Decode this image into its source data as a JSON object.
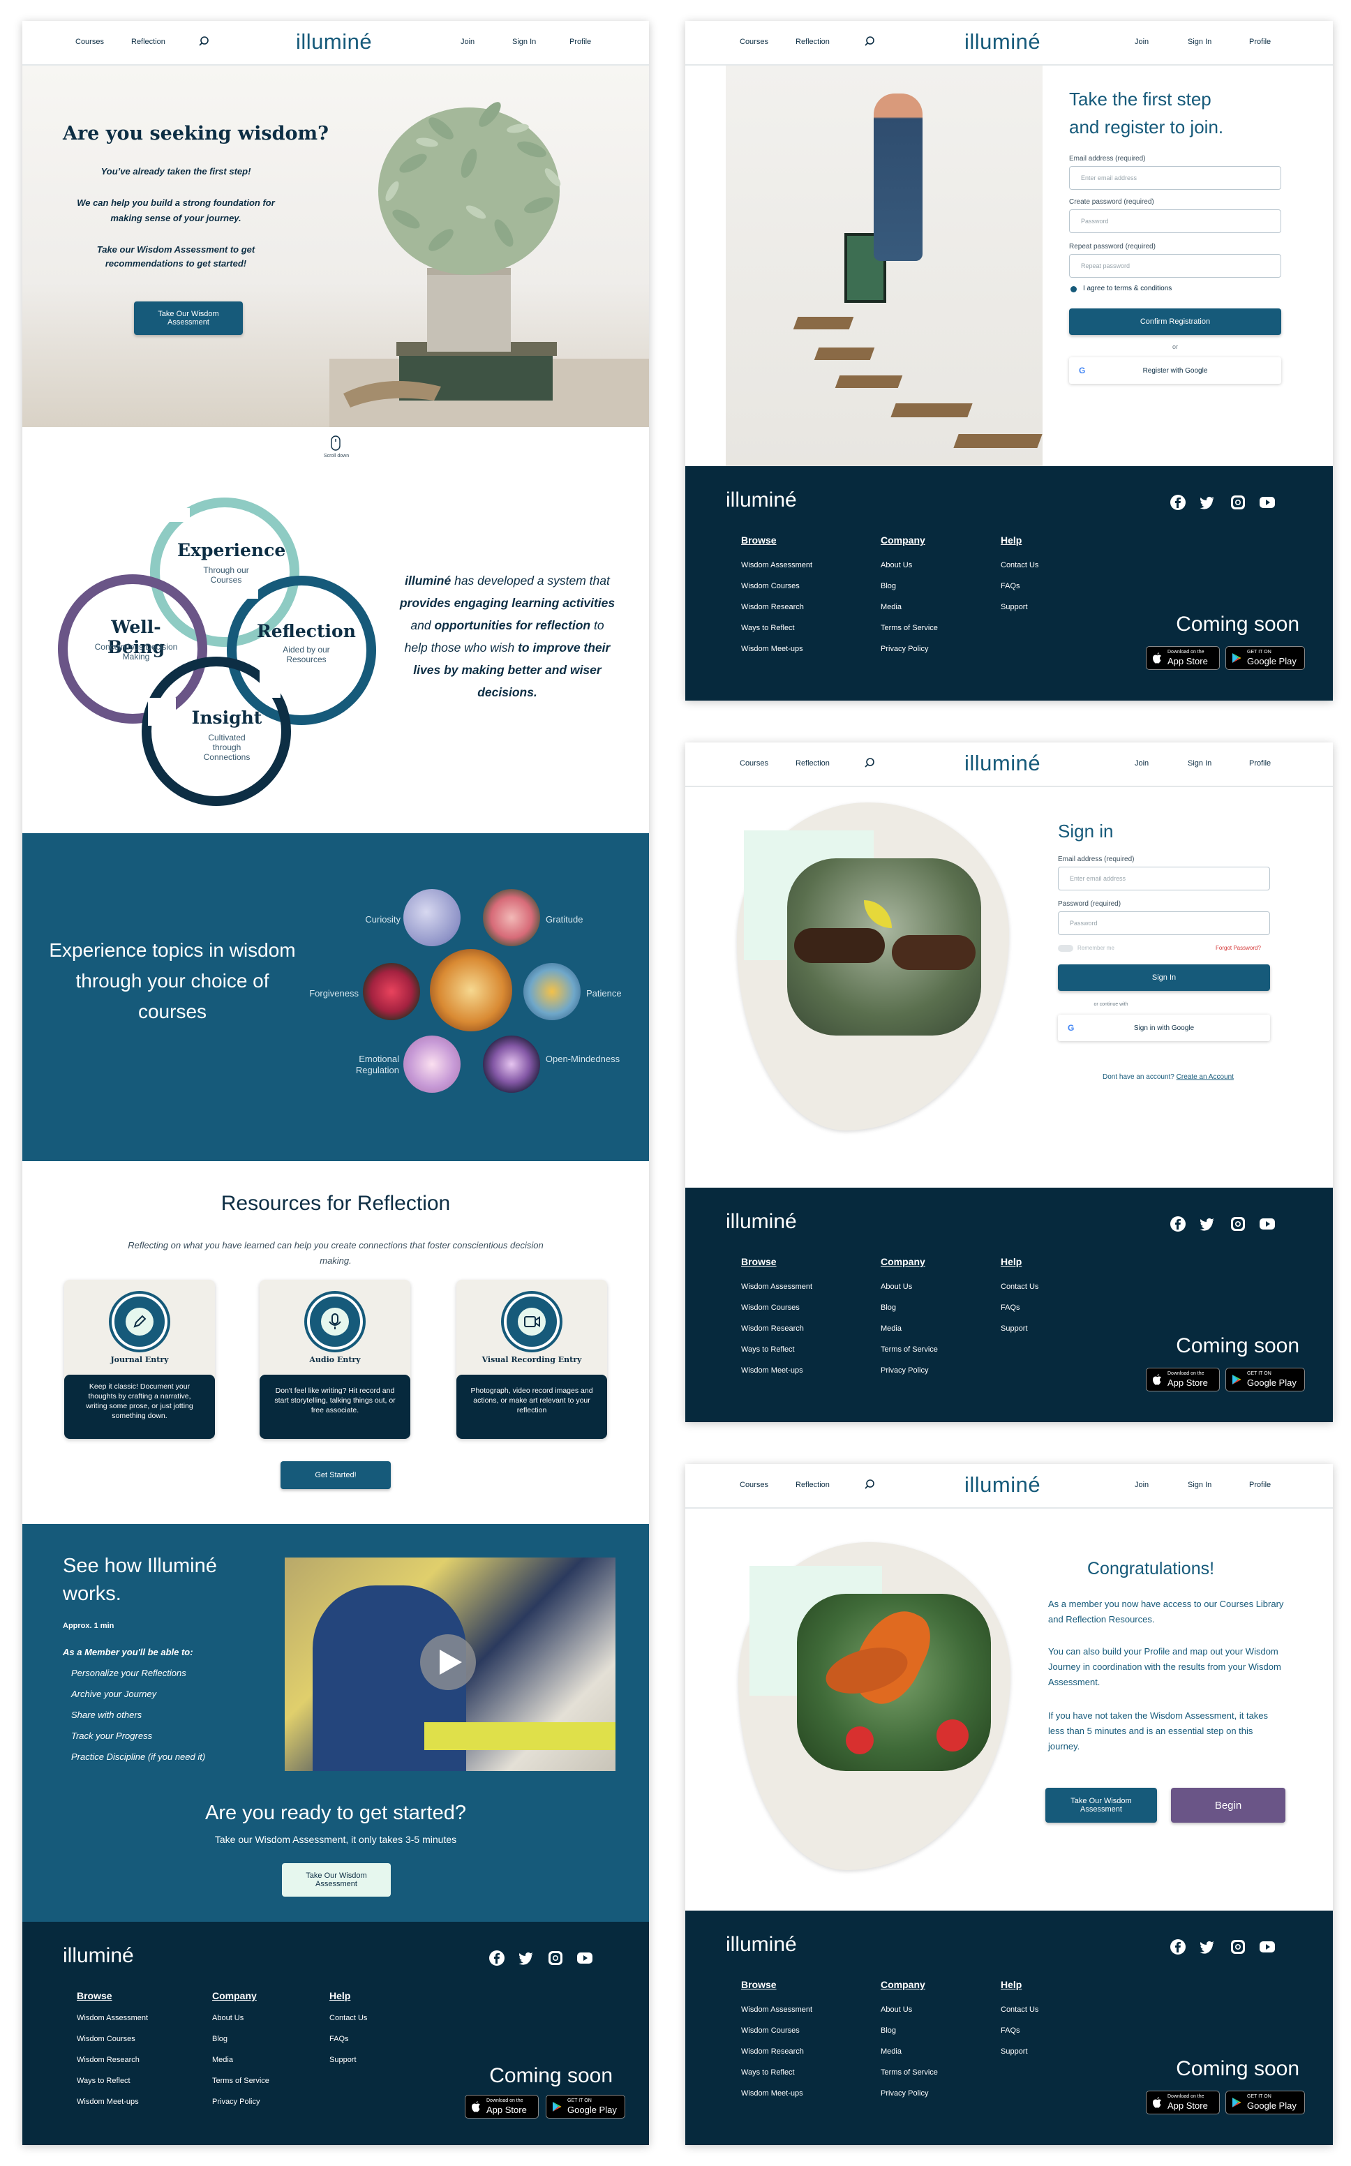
{
  "nav": {
    "courses": "Courses",
    "reflection": "Reflection",
    "logo": "illuminé",
    "join": "Join",
    "sign_in": "Sign In",
    "profile": "Profile"
  },
  "hero": {
    "title": "Are you seeking wisdom?",
    "line1": "You’ve already taken the first step!",
    "line2": "We can help you build a strong foundation for making sense of your journey.",
    "line3": "Take our Wisdom Assessment to get recommendations to get started!",
    "button": "Take Our Wisdom Assessment",
    "scroll": "Scroll down"
  },
  "rings": {
    "experience": {
      "title": "Experience",
      "sub": "Through our Courses"
    },
    "reflection": {
      "title": "Reflection",
      "sub": "Aided by our Resources"
    },
    "wellbeing": {
      "title": "Well-Being",
      "sub": "Conceintious Decision Making"
    },
    "insight": {
      "title": "Insight",
      "sub": "Cultivated through Connections"
    },
    "text_a": "illuminé",
    "text_b": " has developed a system that ",
    "text_c": "provides engaging learning activities",
    "text_d": " and ",
    "text_e": "opportunities for reflection",
    "text_f": " to help those who wish ",
    "text_g": "to improve their lives by making better and wiser decisions."
  },
  "topics": {
    "heading": "Experience topics in wisdom through your choice of courses",
    "curiosity": "Curiosity",
    "gratitude": "Gratitude",
    "forgiveness": "Forgiveness",
    "patience": "Patience",
    "emotional": "Emotional Regulation",
    "open": "Open-Mindedness"
  },
  "resources": {
    "heading": "Resources for Reflection",
    "sub": "Reflecting on what you have  learned can help you create connections that foster conscientious decision making.",
    "cards": [
      {
        "title": "Journal Entry",
        "text": "Keep it classic! Document your thoughts by crafting a narrative, writing some prose, or just jotting something down."
      },
      {
        "title": "Audio Entry",
        "text": "Don't feel like writing? Hit record and start storytelling, talking things out, or free associate."
      },
      {
        "title": "Visual Recording Entry",
        "text": "Photograph, video record images and actions, or make art relevant to your reflection"
      }
    ],
    "button": "Get Started!"
  },
  "how": {
    "heading": "See how Illuminé works.",
    "approx": "Approx. 1 min",
    "member": "As a Member you'll be able to:",
    "items": [
      "Personalize your Reflections",
      "Archive your Journey",
      "Share with others",
      "Track your Progress",
      "Practice Discipline (if you need it)"
    ],
    "ready": "Are you ready to get started?",
    "ready_sub": "Take our Wisdom Assessment, it only takes 3-5 minutes",
    "button": "Take Our Wisdom Assessment"
  },
  "footer": {
    "logo": "illuminé",
    "browse": "Browse",
    "company": "Company",
    "help": "Help",
    "browse_links": [
      "Wisdom Assessment",
      "Wisdom Courses",
      "Wisdom Research",
      "Ways to Reflect",
      "Wisdom Meet-ups"
    ],
    "company_links": [
      "About Us",
      "Blog",
      "Media",
      "Terms of Service",
      "Privacy Policy"
    ],
    "help_links": [
      "Contact Us",
      "FAQs",
      "Support"
    ],
    "coming_soon": "Coming soon",
    "appstore_small": "Download on the",
    "appstore": "App Store",
    "gplay_small": "GET IT ON",
    "gplay": "Google Play"
  },
  "register": {
    "heading": "Take the first step and register to join.",
    "email_label": "Email address (required)",
    "email_ph": "Enter email address",
    "pw_label": "Create password (required)",
    "pw_ph": "Password",
    "pw2_label": "Repeat password (required)",
    "pw2_ph": "Repeat password",
    "agree": "I agree to terms & conditions",
    "button": "Confirm Registration",
    "or": "or",
    "google": "Register with Google"
  },
  "signin": {
    "heading": "Sign in",
    "email_label": "Email address (required)",
    "email_ph": "Enter email address",
    "pw_label": "Password (required)",
    "pw_ph": "Password",
    "remember": "Remember me",
    "forgot": "Forgot Password?",
    "button": "Sign In",
    "or": "or continue with",
    "google": "Sign in with Google",
    "no_account": "Dont have an account?",
    "create": "Create an Account"
  },
  "congrats": {
    "heading": "Congratulations!",
    "p1": "As a member you now have access to our Courses Library and Reflection Resources.",
    "p2": "You can also build your Profile and map out your Wisdom Journey in coordination with the results from your Wisdom Assessment.",
    "p3": "If you have not taken the Wisdom Assessment, it takes less than 5 minutes and is an essential step on this journey.",
    "btn_assess": "Take Our Wisdom Assessment",
    "btn_begin": "Begin"
  }
}
